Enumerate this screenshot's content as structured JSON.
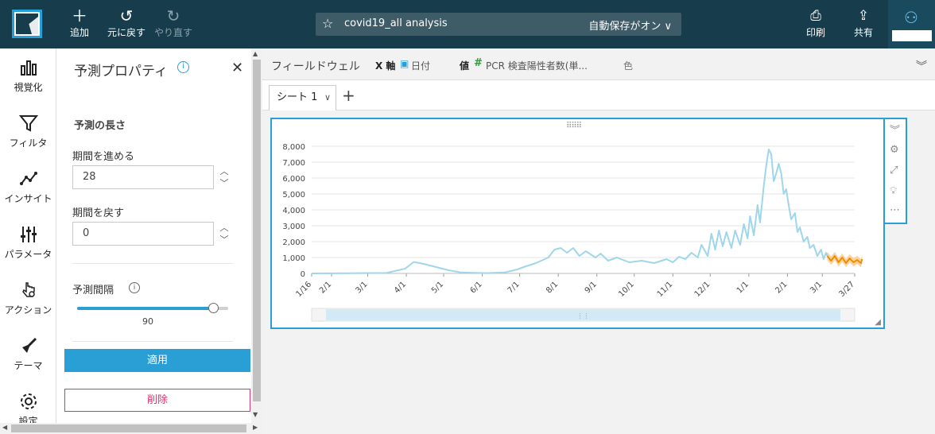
{
  "topbar": {
    "add_label": "追加",
    "undo_label": "元に戻す",
    "redo_label": "やり直す",
    "analysis_name": "covid19_all analysis",
    "autosave_label": "自動保存がオン ∨",
    "print_label": "印刷",
    "share_label": "共有"
  },
  "rail": {
    "items": [
      {
        "label": "視覚化",
        "icon": "bar-chart-icon"
      },
      {
        "label": "フィルタ",
        "icon": "filter-icon"
      },
      {
        "label": "インサイト",
        "icon": "insight-icon"
      },
      {
        "label": "パラメータ",
        "icon": "sliders-icon"
      },
      {
        "label": "アクション",
        "icon": "action-icon"
      },
      {
        "label": "テーマ",
        "icon": "brush-icon"
      },
      {
        "label": "設定",
        "icon": "gear-icon"
      }
    ]
  },
  "panel": {
    "title": "予測プロパティ",
    "forecast_length_heading": "予測の長さ",
    "periods_forward_label": "期間を進める",
    "periods_forward_value": "28",
    "periods_backward_label": "期間を戻す",
    "periods_backward_value": "0",
    "prediction_interval_label": "予測間隔",
    "prediction_interval_value": "90",
    "prediction_interval_fraction": 0.9,
    "apply_label": "適用",
    "delete_label": "削除"
  },
  "fieldwells": {
    "title": "フィールドウェル",
    "x_key": "X 軸",
    "x_value": "日付",
    "value_key": "値",
    "value_field": "PCR 検査陽性者数(単...",
    "color_key": "色"
  },
  "sheet": {
    "tab_label": "シート 1"
  },
  "colors": {
    "topbar": "#173c4c",
    "accent": "#2a9fd6",
    "actual_line": "#9fd6ea",
    "forecast_line": "#f08c00",
    "forecast_band": "#fbc98a",
    "delete": "#d9366f"
  },
  "chart_data": {
    "type": "line",
    "title": "",
    "xlabel": "",
    "ylabel": "",
    "ylim": [
      0,
      8000
    ],
    "y_ticks": [
      "0",
      "1,000",
      "2,000",
      "3,000",
      "4,000",
      "5,000",
      "6,000",
      "7,000",
      "8,000"
    ],
    "x_ticks": [
      "1/16",
      "2/1",
      "3/1",
      "4/1",
      "5/1",
      "6/1",
      "7/1",
      "8/1",
      "9/1",
      "10/1",
      "11/1",
      "12/1",
      "1/1",
      "2/1",
      "3/1",
      "3/27"
    ],
    "x_tick_index": [
      0,
      16,
      45,
      76,
      106,
      137,
      167,
      198,
      229,
      259,
      290,
      320,
      351,
      382,
      410,
      436
    ],
    "series": [
      {
        "values": [
          [
            0,
            0
          ],
          [
            30,
            10
          ],
          [
            60,
            30
          ],
          [
            75,
            300
          ],
          [
            82,
            720
          ],
          [
            90,
            600
          ],
          [
            100,
            400
          ],
          [
            110,
            200
          ],
          [
            120,
            60
          ],
          [
            140,
            20
          ],
          [
            155,
            60
          ],
          [
            165,
            250
          ],
          [
            172,
            450
          ],
          [
            180,
            650
          ],
          [
            190,
            1000
          ],
          [
            195,
            1500
          ],
          [
            200,
            1600
          ],
          [
            205,
            1300
          ],
          [
            210,
            1600
          ],
          [
            215,
            1100
          ],
          [
            220,
            1400
          ],
          [
            228,
            1000
          ],
          [
            232,
            1250
          ],
          [
            238,
            800
          ],
          [
            245,
            1000
          ],
          [
            255,
            700
          ],
          [
            265,
            800
          ],
          [
            275,
            650
          ],
          [
            285,
            900
          ],
          [
            290,
            700
          ],
          [
            295,
            1050
          ],
          [
            300,
            900
          ],
          [
            305,
            1300
          ],
          [
            310,
            1000
          ],
          [
            313,
            1800
          ],
          [
            318,
            1100
          ],
          [
            321,
            2500
          ],
          [
            324,
            1500
          ],
          [
            327,
            2700
          ],
          [
            330,
            1700
          ],
          [
            333,
            2600
          ],
          [
            337,
            1600
          ],
          [
            340,
            2700
          ],
          [
            344,
            1800
          ],
          [
            347,
            3100
          ],
          [
            350,
            2200
          ],
          [
            352,
            3600
          ],
          [
            355,
            2400
          ],
          [
            358,
            4300
          ],
          [
            360,
            3200
          ],
          [
            363,
            5500
          ],
          [
            365,
            6800
          ],
          [
            367,
            7800
          ],
          [
            369,
            7500
          ],
          [
            371,
            5800
          ],
          [
            373,
            6300
          ],
          [
            375,
            6900
          ],
          [
            377,
            6300
          ],
          [
            379,
            5000
          ],
          [
            381,
            5300
          ],
          [
            383,
            4300
          ],
          [
            385,
            3400
          ],
          [
            388,
            3800
          ],
          [
            390,
            2600
          ],
          [
            392,
            2900
          ],
          [
            395,
            2000
          ],
          [
            398,
            2300
          ],
          [
            400,
            1600
          ],
          [
            403,
            1800
          ],
          [
            406,
            1100
          ],
          [
            409,
            1500
          ],
          [
            411,
            900
          ],
          [
            413,
            1300
          ],
          [
            414,
            1100
          ]
        ]
      },
      {
        "values": [
          [
            414,
            1100
          ],
          [
            417,
            800
          ],
          [
            420,
            1100
          ],
          [
            423,
            700
          ],
          [
            426,
            1000
          ],
          [
            429,
            650
          ],
          [
            432,
            950
          ],
          [
            435,
            700
          ],
          [
            438,
            850
          ],
          [
            441,
            650
          ],
          [
            442,
            900
          ]
        ]
      }
    ],
    "forecast_band_span": [
      414,
      442
    ],
    "forecast_band_halfwidth": 260
  }
}
